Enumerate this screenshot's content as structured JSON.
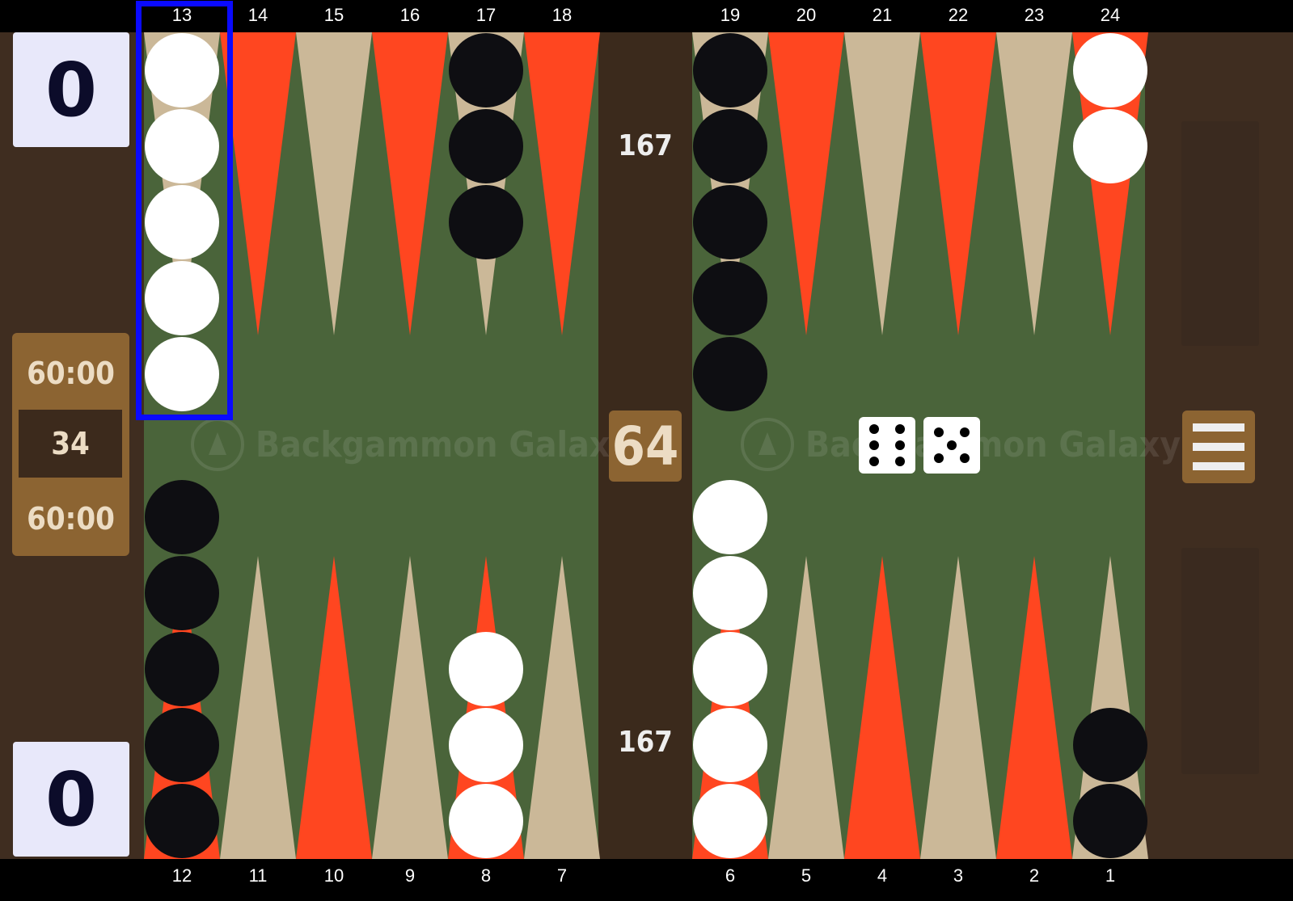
{
  "brand": "Backgammon Galaxy",
  "colors": {
    "board": "#4a643a",
    "frame": "#3f2d20",
    "bar": "#3b2a1c",
    "point_red": "#ff4620",
    "point_tan": "#cbb898",
    "checker_white": "#ffffff",
    "checker_black": "#0e0e12",
    "panel_gold": "#8c6432",
    "score_bg": "#e8e8fa",
    "highlight": "#0a0aff"
  },
  "scores": {
    "top": "0",
    "bottom": "0"
  },
  "clocks": {
    "top": "60:00",
    "bottom": "60:00",
    "middle": "34"
  },
  "pip_counts": {
    "top": "167",
    "bottom": "167"
  },
  "doubling_cube": "64",
  "dice": [
    6,
    5
  ],
  "top_point_labels": [
    "13",
    "14",
    "15",
    "16",
    "17",
    "18",
    "19",
    "20",
    "21",
    "22",
    "23",
    "24"
  ],
  "bottom_point_labels": [
    "12",
    "11",
    "10",
    "9",
    "8",
    "7",
    "6",
    "5",
    "4",
    "3",
    "2",
    "1"
  ],
  "checkers": [
    {
      "point": 13,
      "color": "white",
      "count": 5
    },
    {
      "point": 17,
      "color": "black",
      "count": 3
    },
    {
      "point": 19,
      "color": "black",
      "count": 5
    },
    {
      "point": 24,
      "color": "white",
      "count": 2
    },
    {
      "point": 12,
      "color": "black",
      "count": 5
    },
    {
      "point": 8,
      "color": "white",
      "count": 3
    },
    {
      "point": 6,
      "color": "white",
      "count": 5
    },
    {
      "point": 1,
      "color": "black",
      "count": 2
    }
  ],
  "highlighted_point": 13,
  "menu": {
    "icon": "hamburger-menu-icon"
  }
}
